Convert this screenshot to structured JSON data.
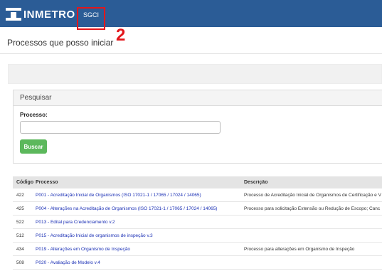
{
  "header": {
    "logo_text": "INMETRO",
    "nav_item": "SGCI",
    "annotation_number": "2",
    "colors": {
      "bar": "#2b5c96",
      "highlight": "#e3161b"
    }
  },
  "page": {
    "title": "Processos que posso iniciar"
  },
  "search": {
    "panel_title": "Pesquisar",
    "field_label": "Processo:",
    "field_value": "",
    "button_label": "Buscar",
    "button_color": "#5cb85c"
  },
  "table": {
    "headers": [
      "Código",
      "Processo",
      "Descrição"
    ],
    "rows": [
      {
        "code": "422",
        "process": "P001 - Acreditação Inicial de Organismos (ISO 17021-1 / 17065 / 17024 / 14065)",
        "description": "Processo de Acreditação Inicial de Organismos de Certificação e V"
      },
      {
        "code": "425",
        "process": "P004 - Alterações na Acreditação de Organismos (ISO 17021-1 / 17065 / 17024 / 14065)",
        "description": "Processo para solicitação Extensão ou Redução de Escopo; Canc"
      },
      {
        "code": "522",
        "process": "P013 - Edital para Credenciamento v.2",
        "description": ""
      },
      {
        "code": "512",
        "process": "P015 - Acreditação Inicial de organismos de inspeção v.3",
        "description": ""
      },
      {
        "code": "434",
        "process": "P019 - Alterações em Organismo de Inspeção",
        "description": "Processo para alterações em Organismo de Inspeção"
      },
      {
        "code": "508",
        "process": "P020 - Avaliação de Modelo v.4",
        "description": ""
      }
    ]
  }
}
